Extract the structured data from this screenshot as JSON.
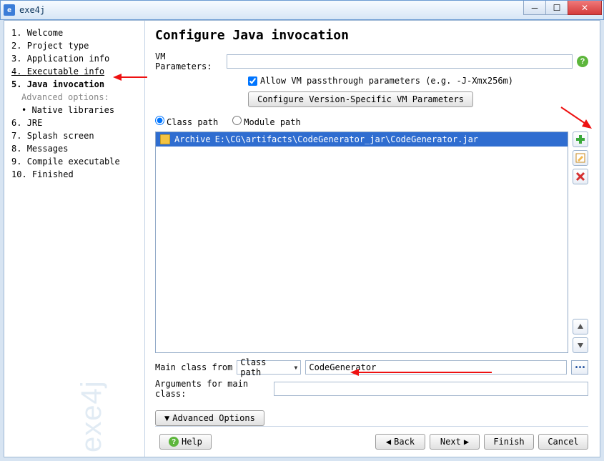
{
  "window": {
    "title": "exe4j"
  },
  "sidebar": {
    "steps": [
      {
        "n": "1.",
        "label": "Welcome"
      },
      {
        "n": "2.",
        "label": "Project type"
      },
      {
        "n": "3.",
        "label": "Application info"
      },
      {
        "n": "4.",
        "label": "Executable info"
      },
      {
        "n": "5.",
        "label": "Java invocation"
      },
      {
        "n": "6.",
        "label": "JRE"
      },
      {
        "n": "7.",
        "label": "Splash screen"
      },
      {
        "n": "8.",
        "label": "Messages"
      },
      {
        "n": "9.",
        "label": "Compile executable"
      },
      {
        "n": "10.",
        "label": "Finished"
      }
    ],
    "advanced_label": "Advanced options:",
    "advanced_items": [
      "Native libraries"
    ],
    "watermark": "exe4j"
  },
  "content": {
    "heading": "Configure Java invocation",
    "vm_label": "VM Parameters:",
    "vm_value": "",
    "allow_passthrough": "Allow VM passthrough parameters (e.g. -J-Xmx256m)",
    "allow_checked": true,
    "cfg_version_btn": "Configure Version-Specific VM Parameters",
    "radio_classpath": "Class path",
    "radio_modulepath": "Module path",
    "list_item_prefix": "Archive",
    "list_item_path": "E:\\CG\\artifacts\\CodeGenerator_jar\\CodeGenerator.jar",
    "mainclass_label": "Main class from",
    "mainclass_source": "Class path",
    "mainclass_value": "CodeGenerator",
    "args_label": "Arguments for main class:",
    "args_value": "",
    "adv_btn": "Advanced Options",
    "help_btn": "Help",
    "back_btn": "Back",
    "next_btn": "Next",
    "finish_btn": "Finish",
    "cancel_btn": "Cancel"
  }
}
